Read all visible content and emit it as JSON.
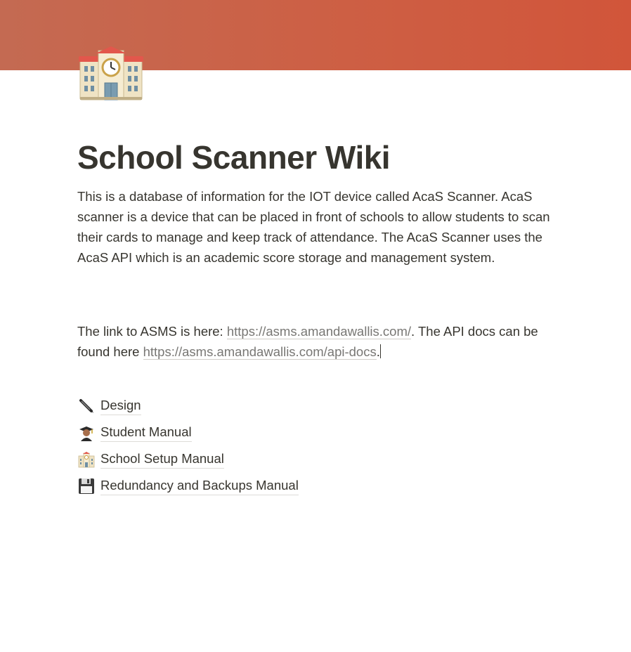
{
  "page": {
    "cover_color": "#cd5f44",
    "icon": "school-building-icon",
    "title": "School Scanner Wiki"
  },
  "intro": {
    "text": "This is a database of information for the IOT device called AcaS Scanner. AcaS scanner is a device that can be placed in front of schools to allow students to scan their cards to manage and keep track of attendance. The AcaS Scanner uses the AcaS API which is an academic score storage and management system."
  },
  "links_paragraph": {
    "prefix": "The link to ASMS  is here: ",
    "asms_url": "https://asms.amandawallis.com/",
    "middle": ". The API docs can be found here ",
    "api_docs_url": "https://asms.amandawallis.com/api-docs",
    "suffix": "."
  },
  "subpages": [
    {
      "icon": "pen-icon",
      "label": "Design"
    },
    {
      "icon": "student-icon",
      "label": "Student Manual"
    },
    {
      "icon": "school-icon",
      "label": "School Setup Manual"
    },
    {
      "icon": "floppy-disk-icon",
      "label": "Redundancy and Backups Manual"
    }
  ]
}
